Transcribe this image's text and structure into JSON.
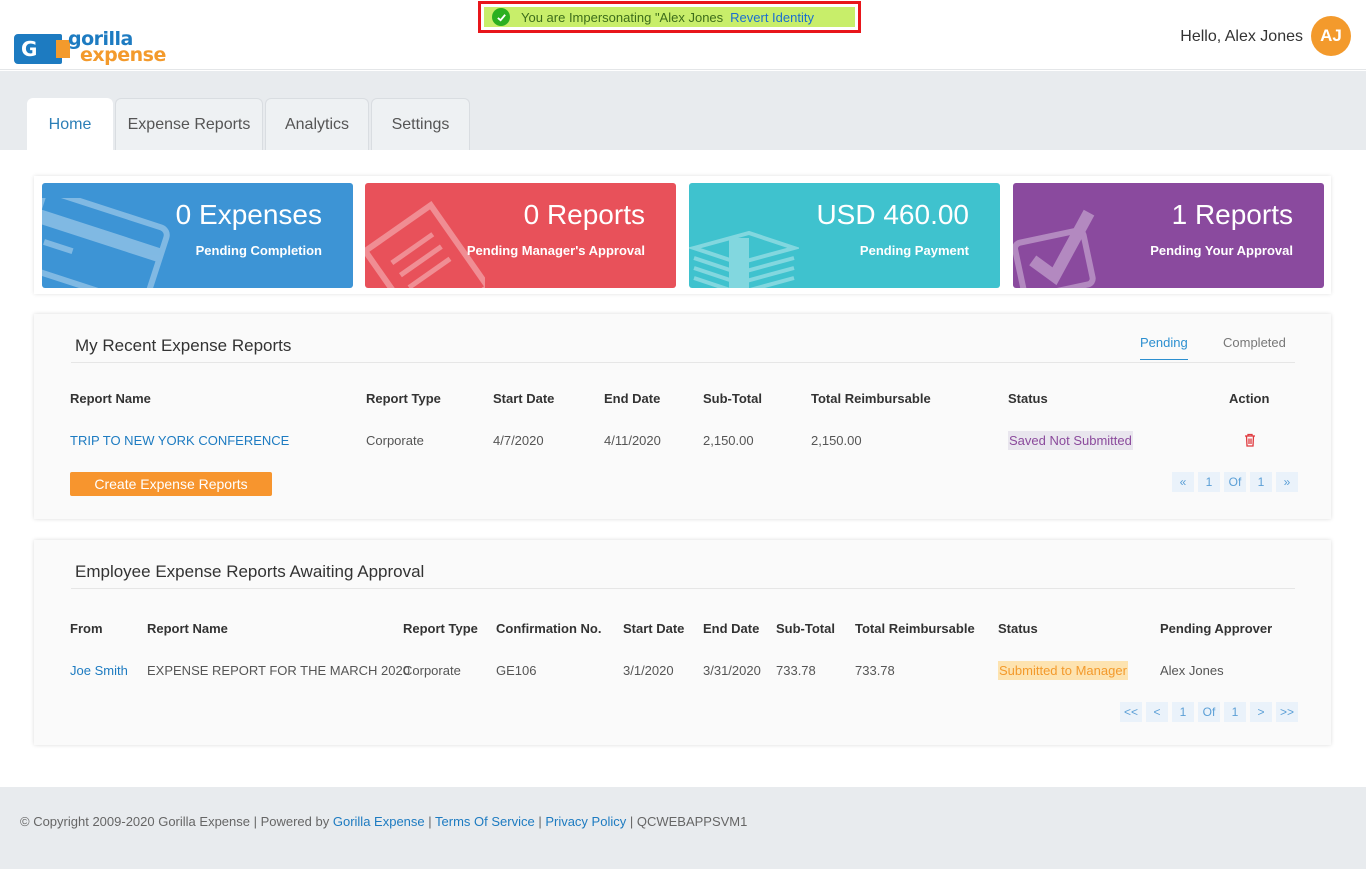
{
  "header": {
    "logo_text_1": "gorilla",
    "logo_text_2": "expense",
    "logo_mark": "G",
    "impersonation_text": "You are Impersonating \"Alex Jones",
    "revert_label": "Revert Identity",
    "greeting": "Hello, Alex Jones",
    "avatar_initials": "AJ"
  },
  "tabs": [
    {
      "label": "Home",
      "active": true
    },
    {
      "label": "Expense Reports",
      "active": false
    },
    {
      "label": "Analytics",
      "active": false
    },
    {
      "label": "Settings",
      "active": false
    }
  ],
  "stats": [
    {
      "value": "0 Expenses",
      "label": "Pending Completion",
      "color": "#3d94d5",
      "icon": "credit-card-icon"
    },
    {
      "value": "0 Reports",
      "label": "Pending Manager's Approval",
      "color": "#e8515a",
      "icon": "document-icon"
    },
    {
      "value": "USD 460.00",
      "label": "Pending Payment",
      "color": "#3fc2ce",
      "icon": "cash-stack-icon"
    },
    {
      "value": "1 Reports",
      "label": "Pending Your Approval",
      "color": "#8a4a9e",
      "icon": "checkbox-icon"
    }
  ],
  "recent": {
    "title": "My Recent Expense Reports",
    "subtabs": [
      "Pending",
      "Completed"
    ],
    "columns": [
      "Report Name",
      "Report Type",
      "Start Date",
      "End Date",
      "Sub-Total",
      "Total Reimbursable",
      "Status",
      "Action"
    ],
    "rows": [
      {
        "name": "TRIP TO NEW YORK CONFERENCE",
        "type": "Corporate",
        "start": "4/7/2020",
        "end": "4/11/2020",
        "subtotal": "2,150.00",
        "total": "2,150.00",
        "status": "Saved Not Submitted"
      }
    ],
    "create_label": "Create Expense Reports",
    "pager": {
      "first": "«",
      "page": "1",
      "of": "Of",
      "total": "1",
      "last": "»"
    }
  },
  "awaiting": {
    "title": "Employee Expense Reports Awaiting Approval",
    "columns": [
      "From",
      "Report Name",
      "Report Type",
      "Confirmation No.",
      "Start Date",
      "End Date",
      "Sub-Total",
      "Total Reimbursable",
      "Status",
      "Pending Approver"
    ],
    "rows": [
      {
        "from": "Joe Smith",
        "name": "EXPENSE REPORT FOR THE MARCH 2020",
        "type": "Corporate",
        "conf": "GE106",
        "start": "3/1/2020",
        "end": "3/31/2020",
        "subtotal": "733.78",
        "total": "733.78",
        "status": "Submitted to Manager",
        "approver": "Alex Jones"
      }
    ],
    "pager": {
      "first": "<<",
      "prev": "<",
      "page": "1",
      "of": "Of",
      "total": "1",
      "next": ">",
      "last": ">>"
    }
  },
  "footer": {
    "copyright": "© Copyright 2009-2020 Gorilla Expense | Powered by ",
    "powered_link": "Gorilla Expense",
    "sep1": " | ",
    "terms": "Terms Of Service",
    "sep2": " | ",
    "privacy": "Privacy Policy",
    "server": " | QCWEBAPPSVM1"
  }
}
